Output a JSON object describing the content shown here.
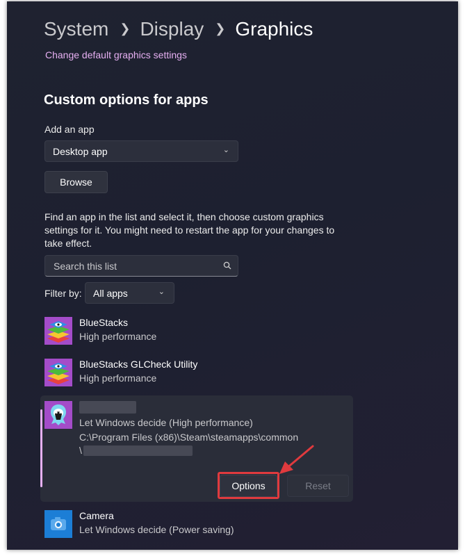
{
  "breadcrumb": {
    "items": [
      "System",
      "Display",
      "Graphics"
    ]
  },
  "link": "Change default graphics settings",
  "section_title": "Custom options for apps",
  "add_app": {
    "label": "Add an app",
    "dropdown_value": "Desktop app",
    "browse_label": "Browse"
  },
  "description": "Find an app in the list and select it, then choose custom graphics settings for it. You might need to restart the app for your changes to take effect.",
  "search": {
    "placeholder": "Search this list"
  },
  "filter": {
    "label": "Filter by:",
    "value": "All apps"
  },
  "apps": [
    {
      "name": "BlueStacks",
      "subtitle": "High performance",
      "icon": "bluestacks-icon"
    },
    {
      "name": "BlueStacks GLCheck Utility",
      "subtitle": "High performance",
      "icon": "bluestacks-icon"
    },
    {
      "name": "",
      "subtitle": "Let Windows decide (High performance)",
      "path": "C:\\Program Files (x86)\\Steam\\steamapps\\common",
      "path2": "\\",
      "icon": "game-app-icon",
      "options_label": "Options",
      "reset_label": "Reset"
    },
    {
      "name": "Camera",
      "subtitle": "Let Windows decide (Power saving)",
      "icon": "camera-icon"
    }
  ],
  "colors": {
    "accent": "#e6b0f2",
    "highlight": "#e03a3e",
    "background": "#1f2230"
  }
}
